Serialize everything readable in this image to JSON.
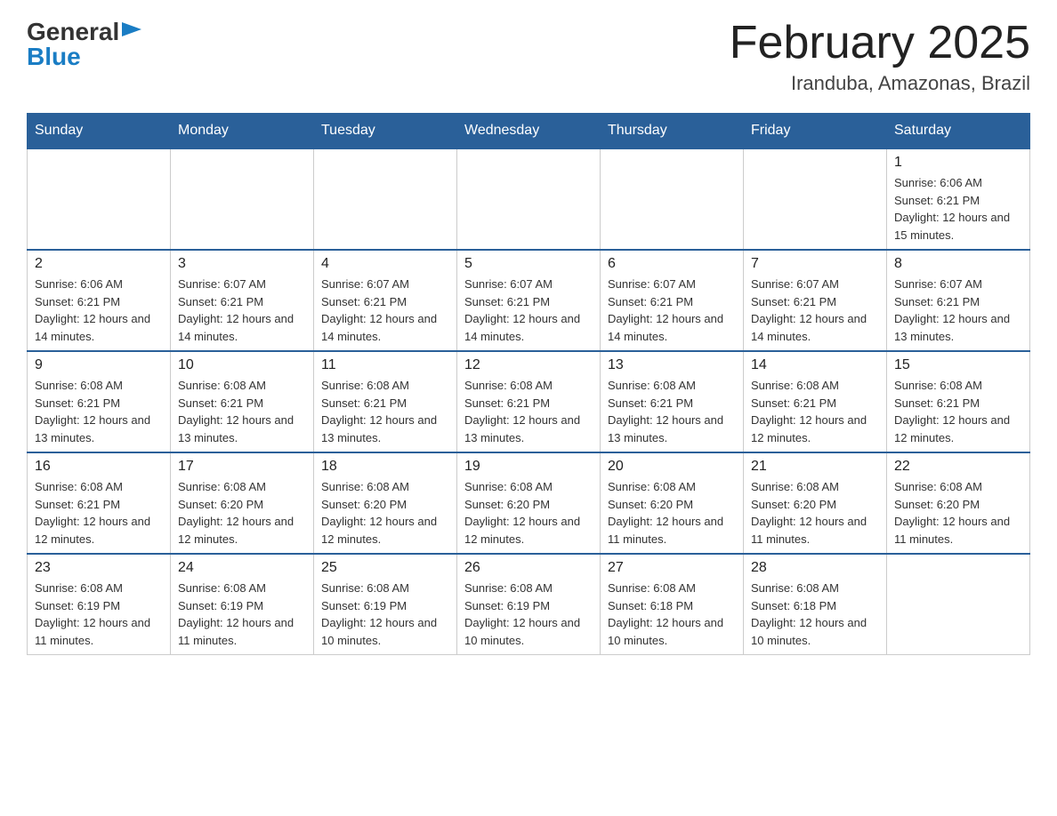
{
  "header": {
    "title": "February 2025",
    "subtitle": "Iranduba, Amazonas, Brazil",
    "logo_general": "General",
    "logo_blue": "Blue"
  },
  "weekdays": [
    "Sunday",
    "Monday",
    "Tuesday",
    "Wednesday",
    "Thursday",
    "Friday",
    "Saturday"
  ],
  "weeks": [
    [
      {
        "day": "",
        "info": ""
      },
      {
        "day": "",
        "info": ""
      },
      {
        "day": "",
        "info": ""
      },
      {
        "day": "",
        "info": ""
      },
      {
        "day": "",
        "info": ""
      },
      {
        "day": "",
        "info": ""
      },
      {
        "day": "1",
        "info": "Sunrise: 6:06 AM\nSunset: 6:21 PM\nDaylight: 12 hours and 15 minutes."
      }
    ],
    [
      {
        "day": "2",
        "info": "Sunrise: 6:06 AM\nSunset: 6:21 PM\nDaylight: 12 hours and 14 minutes."
      },
      {
        "day": "3",
        "info": "Sunrise: 6:07 AM\nSunset: 6:21 PM\nDaylight: 12 hours and 14 minutes."
      },
      {
        "day": "4",
        "info": "Sunrise: 6:07 AM\nSunset: 6:21 PM\nDaylight: 12 hours and 14 minutes."
      },
      {
        "day": "5",
        "info": "Sunrise: 6:07 AM\nSunset: 6:21 PM\nDaylight: 12 hours and 14 minutes."
      },
      {
        "day": "6",
        "info": "Sunrise: 6:07 AM\nSunset: 6:21 PM\nDaylight: 12 hours and 14 minutes."
      },
      {
        "day": "7",
        "info": "Sunrise: 6:07 AM\nSunset: 6:21 PM\nDaylight: 12 hours and 14 minutes."
      },
      {
        "day": "8",
        "info": "Sunrise: 6:07 AM\nSunset: 6:21 PM\nDaylight: 12 hours and 13 minutes."
      }
    ],
    [
      {
        "day": "9",
        "info": "Sunrise: 6:08 AM\nSunset: 6:21 PM\nDaylight: 12 hours and 13 minutes."
      },
      {
        "day": "10",
        "info": "Sunrise: 6:08 AM\nSunset: 6:21 PM\nDaylight: 12 hours and 13 minutes."
      },
      {
        "day": "11",
        "info": "Sunrise: 6:08 AM\nSunset: 6:21 PM\nDaylight: 12 hours and 13 minutes."
      },
      {
        "day": "12",
        "info": "Sunrise: 6:08 AM\nSunset: 6:21 PM\nDaylight: 12 hours and 13 minutes."
      },
      {
        "day": "13",
        "info": "Sunrise: 6:08 AM\nSunset: 6:21 PM\nDaylight: 12 hours and 13 minutes."
      },
      {
        "day": "14",
        "info": "Sunrise: 6:08 AM\nSunset: 6:21 PM\nDaylight: 12 hours and 12 minutes."
      },
      {
        "day": "15",
        "info": "Sunrise: 6:08 AM\nSunset: 6:21 PM\nDaylight: 12 hours and 12 minutes."
      }
    ],
    [
      {
        "day": "16",
        "info": "Sunrise: 6:08 AM\nSunset: 6:21 PM\nDaylight: 12 hours and 12 minutes."
      },
      {
        "day": "17",
        "info": "Sunrise: 6:08 AM\nSunset: 6:20 PM\nDaylight: 12 hours and 12 minutes."
      },
      {
        "day": "18",
        "info": "Sunrise: 6:08 AM\nSunset: 6:20 PM\nDaylight: 12 hours and 12 minutes."
      },
      {
        "day": "19",
        "info": "Sunrise: 6:08 AM\nSunset: 6:20 PM\nDaylight: 12 hours and 12 minutes."
      },
      {
        "day": "20",
        "info": "Sunrise: 6:08 AM\nSunset: 6:20 PM\nDaylight: 12 hours and 11 minutes."
      },
      {
        "day": "21",
        "info": "Sunrise: 6:08 AM\nSunset: 6:20 PM\nDaylight: 12 hours and 11 minutes."
      },
      {
        "day": "22",
        "info": "Sunrise: 6:08 AM\nSunset: 6:20 PM\nDaylight: 12 hours and 11 minutes."
      }
    ],
    [
      {
        "day": "23",
        "info": "Sunrise: 6:08 AM\nSunset: 6:19 PM\nDaylight: 12 hours and 11 minutes."
      },
      {
        "day": "24",
        "info": "Sunrise: 6:08 AM\nSunset: 6:19 PM\nDaylight: 12 hours and 11 minutes."
      },
      {
        "day": "25",
        "info": "Sunrise: 6:08 AM\nSunset: 6:19 PM\nDaylight: 12 hours and 10 minutes."
      },
      {
        "day": "26",
        "info": "Sunrise: 6:08 AM\nSunset: 6:19 PM\nDaylight: 12 hours and 10 minutes."
      },
      {
        "day": "27",
        "info": "Sunrise: 6:08 AM\nSunset: 6:18 PM\nDaylight: 12 hours and 10 minutes."
      },
      {
        "day": "28",
        "info": "Sunrise: 6:08 AM\nSunset: 6:18 PM\nDaylight: 12 hours and 10 minutes."
      },
      {
        "day": "",
        "info": ""
      }
    ]
  ]
}
